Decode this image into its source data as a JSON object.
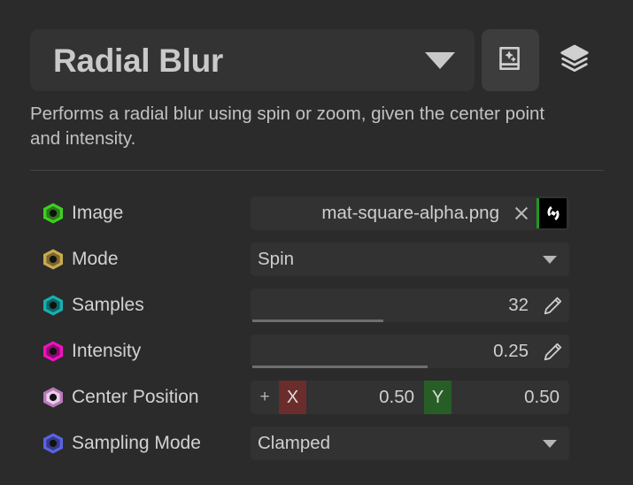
{
  "header": {
    "title": "Radial Blur",
    "dropdown_icon": "chevron-down-icon",
    "buttons": [
      {
        "name": "docs-button",
        "icon": "book-sparkle-icon",
        "active": true
      },
      {
        "name": "layers-button",
        "icon": "layers-stack-icon",
        "active": false
      }
    ]
  },
  "description": "Performs a radial blur using spin or zoom, given the center point and intensity.",
  "properties": [
    {
      "label": "Image",
      "socket_color": "#3fcf21",
      "socket_ring": "#2a7a18",
      "type": "asset",
      "value": "mat-square-alpha.png",
      "clear_label": "×",
      "thumbnail": "texture-thumbnail"
    },
    {
      "label": "Mode",
      "socket_color": "#caa94f",
      "socket_ring": "#7a672c",
      "type": "dropdown",
      "value": "Spin"
    },
    {
      "label": "Samples",
      "socket_color": "#18b0b0",
      "socket_ring": "#0d6666",
      "type": "slider",
      "value": "32",
      "fill_percent": 41
    },
    {
      "label": "Intensity",
      "socket_color": "#f012bf",
      "socket_ring": "#8c0a70",
      "type": "slider",
      "value": "0.25",
      "fill_percent": 55
    },
    {
      "label": "Center Position",
      "socket_color": "#e6b3e6",
      "socket_ring": "#9b6f9b",
      "type": "vector",
      "plus_label": "+",
      "axes": [
        {
          "axis": "X",
          "value": "0.50",
          "badge_color": "#6b2c2c"
        },
        {
          "axis": "Y",
          "value": "0.50",
          "badge_color": "#265e26"
        }
      ]
    },
    {
      "label": "Sampling Mode",
      "socket_color": "#5c63e0",
      "socket_ring": "#343a8c",
      "type": "dropdown",
      "value": "Clamped"
    }
  ],
  "colors": {
    "panel_background": "#2b2b2b",
    "title_background": "#333333",
    "field_background": "#323232",
    "text_primary": "#d2d2d2",
    "divider": "#434343"
  }
}
